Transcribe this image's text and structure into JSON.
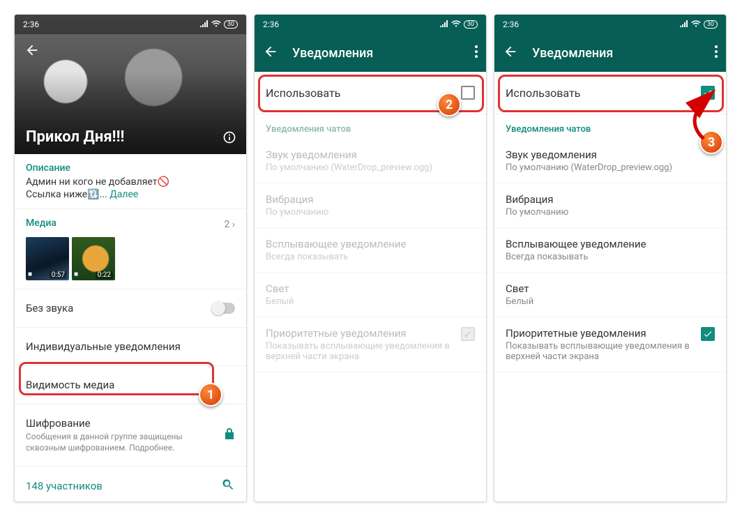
{
  "status": {
    "time": "2:36",
    "battery": "30"
  },
  "screen1": {
    "group_title": "Прикол Дня!!!",
    "desc_heading": "Описание",
    "desc_line1": "Админ ни кого не добавляет🚫",
    "desc_line2_prefix": "Ссылка ниже🔃... ",
    "desc_more": "Далее",
    "media_label": "Медиа",
    "media_count": "2 ›",
    "thumb1_dur": "0:57",
    "thumb2_dur": "0:22",
    "mute_label": "Без звука",
    "custom_notif_label": "Индивидуальные уведомления",
    "visibility_label": "Видимость медиа",
    "encryption_title": "Шифрование",
    "encryption_sub": "Сообщения в данной группе защищены сквозным шифрованием. Подробнее.",
    "participants": "148 участников"
  },
  "notif": {
    "title": "Уведомления",
    "use": "Использовать",
    "section": "Уведомления чатов",
    "sound_t": "Звук уведомления",
    "sound_s": "По умолчанию (WaterDrop_preview.ogg)",
    "vib_t": "Вибрация",
    "vib_s": "По умолчанию",
    "popup_t": "Всплывающее уведомление",
    "popup_s": "Всегда показывать",
    "light_t": "Свет",
    "light_s": "Белый",
    "prio_t": "Приоритетные уведомления",
    "prio_s": "Показывать всплывающие уведомления в верхней части экрана"
  },
  "badges": {
    "b1": "1",
    "b2": "2",
    "b3": "3"
  }
}
